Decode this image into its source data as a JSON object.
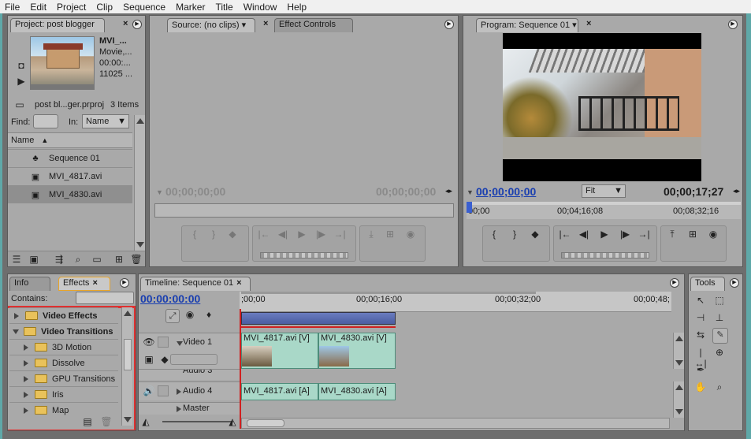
{
  "menu": [
    "File",
    "Edit",
    "Project",
    "Clip",
    "Sequence",
    "Marker",
    "Title",
    "Window",
    "Help"
  ],
  "project": {
    "tab": "Project: post blogger",
    "clip_name": "MVI_...",
    "clip_type": "Movie,...",
    "clip_time": "00:00:...",
    "clip_size": "11025 ...",
    "project_file": "post bl...ger.prproj",
    "item_count": "3 Items",
    "find_label": "Find:",
    "in_label": "In:",
    "in_value": "Name",
    "column_name": "Name",
    "items": [
      {
        "name": "Sequence 01",
        "icon": "sequence-icon"
      },
      {
        "name": "MVI_4817.avi",
        "icon": "av-clip-icon"
      },
      {
        "name": "MVI_4830.avi",
        "icon": "av-clip-icon"
      }
    ]
  },
  "source": {
    "tab": "Source: (no clips)",
    "tab2": "Effect Controls",
    "time_left": "00;00;00;00",
    "time_right": "00;00;00;00"
  },
  "program": {
    "tab": "Program: Sequence 01",
    "time_left": "00;00;00;00",
    "fit": "Fit",
    "time_right": "00;00;17;27",
    "ruler": [
      "00;00",
      "00;04;16;08",
      "00;08;32;16"
    ]
  },
  "effects": {
    "tab_info": "Info",
    "tab_effects": "Effects",
    "contains_label": "Contains:",
    "tree": [
      {
        "label": "Video Effects",
        "level": 0,
        "open": false,
        "bold": true
      },
      {
        "label": "Video Transitions",
        "level": 0,
        "open": true,
        "bold": true
      },
      {
        "label": "3D Motion",
        "level": 1,
        "open": false,
        "bold": false
      },
      {
        "label": "Dissolve",
        "level": 1,
        "open": false,
        "bold": false
      },
      {
        "label": "GPU Transitions",
        "level": 1,
        "open": false,
        "bold": false
      },
      {
        "label": "Iris",
        "level": 1,
        "open": false,
        "bold": false
      },
      {
        "label": "Map",
        "level": 1,
        "open": false,
        "bold": false
      }
    ],
    "highlight_color": "#e03030"
  },
  "timeline": {
    "tab": "Timeline: Sequence 01",
    "timecode": "00:00:00:00",
    "ruler": [
      ";00;00",
      "00;00;16;00",
      "00;00;32;00",
      "00;00;48;"
    ],
    "tracks": [
      {
        "name": "Video 1",
        "type": "video"
      },
      {
        "name": "Audio 3",
        "type": "audio"
      },
      {
        "name": "Audio 4",
        "type": "audio"
      },
      {
        "name": "Master",
        "type": "master"
      }
    ],
    "video_clips": [
      "MVI_4817.avi [V]",
      "MVI_4830.avi [V]"
    ],
    "audio_clips": [
      "MVI_4817.avi [A]",
      "MVI_4830.avi [A]"
    ]
  },
  "tools": {
    "tab": "Tools"
  }
}
